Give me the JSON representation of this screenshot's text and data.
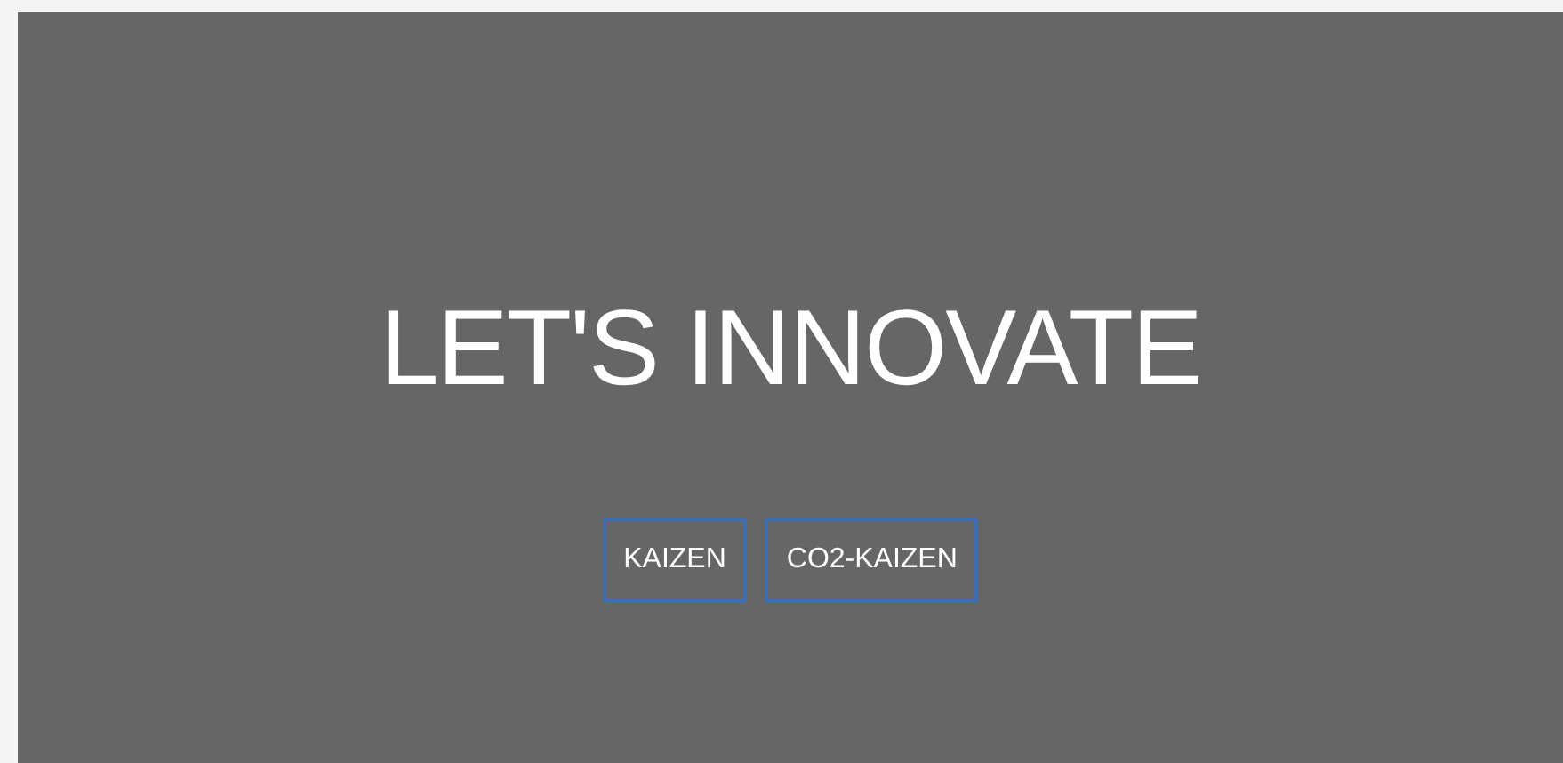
{
  "hero": {
    "title": "LET'S INNOVATE",
    "buttons": [
      "KAIZEN",
      "CO2-KAIZEN"
    ]
  }
}
